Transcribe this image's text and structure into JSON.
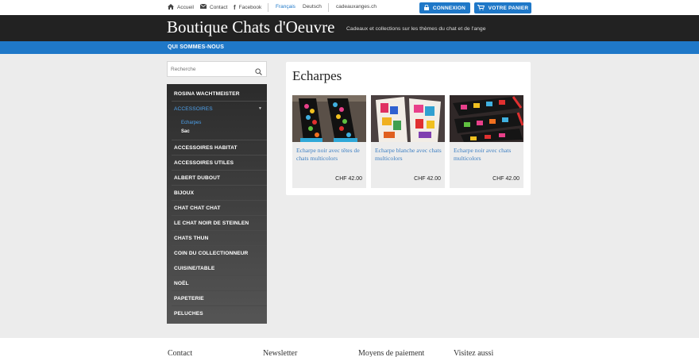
{
  "topbar": {
    "links": [
      {
        "label": "Accueil",
        "icon": "home-icon"
      },
      {
        "label": "Contact",
        "icon": "envelope-icon"
      },
      {
        "label": "Facebook",
        "icon": "facebook-icon"
      }
    ],
    "languages": [
      {
        "label": "Français",
        "active": true
      },
      {
        "label": "Deutsch",
        "active": false
      }
    ],
    "domain": "cadeauxanges.ch",
    "login_label": "CONNEXION",
    "cart_label": "VOTRE PANIER"
  },
  "header": {
    "title": "Boutique Chats d'Oeuvre",
    "tagline": "Cadeaux et collections sur les thèmes du chat et de l'ange"
  },
  "nav": {
    "items": [
      "QUI SOMMES-NOUS"
    ]
  },
  "search": {
    "placeholder": "Recherche"
  },
  "sidebar": {
    "items": [
      {
        "label": "ROSINA WACHTMEISTER"
      },
      {
        "label": "ACCESSOIRES",
        "active": true,
        "sub": [
          {
            "label": "Echarpes",
            "active": true
          },
          {
            "label": "Sac",
            "active": false
          }
        ]
      },
      {
        "label": "ACCESSOIRES HABITAT"
      },
      {
        "label": "ACCESSOIRES UTILES"
      },
      {
        "label": "ALBERT DUBOUT"
      },
      {
        "label": "BIJOUX"
      },
      {
        "label": "CHAT CHAT CHAT"
      },
      {
        "label": "LE CHAT NOIR DE STEINLEN"
      },
      {
        "label": "CHATS THUN"
      },
      {
        "label": "COIN DU COLLECTIONNEUR"
      },
      {
        "label": "CUISINE/TABLE"
      },
      {
        "label": "NOËL"
      },
      {
        "label": "PAPETERIE"
      },
      {
        "label": "PELUCHES"
      }
    ]
  },
  "main": {
    "title": "Echarpes",
    "products": [
      {
        "title": "Echarpe noir avec têtes de chats multicolors",
        "price": "CHF 42.00"
      },
      {
        "title": "Echarpe blanche avec chats multicolors",
        "price": "CHF 42.00"
      },
      {
        "title": "Echarpe noir avec chats multicolors",
        "price": "CHF 42.00"
      }
    ]
  },
  "footer": {
    "headings": [
      "Contact",
      "Newsletter",
      "Moyens de paiement",
      "Visitez aussi"
    ]
  },
  "colors": {
    "accent": "#1f78c8",
    "header_bg": "#222222",
    "page_bg": "#ececec",
    "link": "#3d7fc2"
  }
}
